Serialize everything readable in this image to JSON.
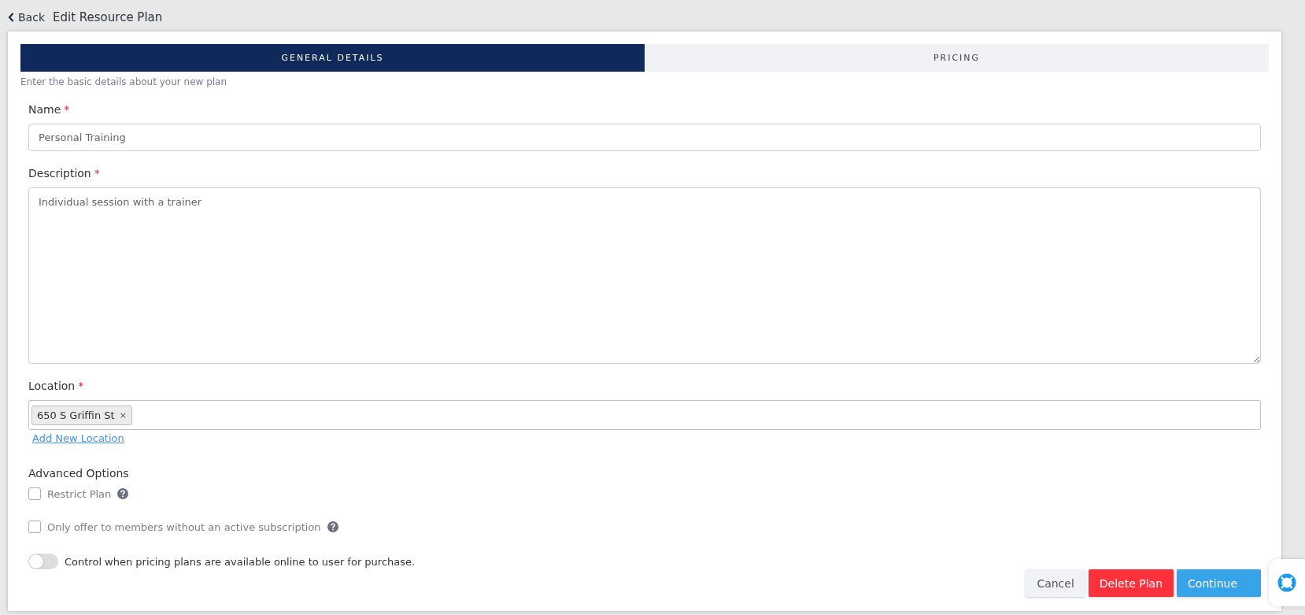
{
  "header": {
    "back": "Back",
    "title": "Edit Resource Plan"
  },
  "tabs": [
    {
      "label": "GENERAL DETAILS",
      "selected": true
    },
    {
      "label": "PRICING",
      "selected": false
    }
  ],
  "hint": "Enter the basic details about your new plan",
  "fields": [
    {
      "kind": "input",
      "label": "Name",
      "required_mark": "*",
      "value": "Personal Training"
    },
    {
      "kind": "textarea",
      "label": "Description",
      "required_mark": "*",
      "value": "Individual session with a trainer"
    },
    {
      "kind": "tags",
      "label": "Location",
      "required_mark": "*",
      "tags": [
        "650 S Griffin St"
      ],
      "tag_remove": "×",
      "link": "Add New Location"
    }
  ],
  "advanced": {
    "title": "Advanced Options",
    "options": [
      {
        "kind": "checkbox",
        "label": "Restrict Plan",
        "checked": false,
        "help": true
      },
      {
        "kind": "checkbox",
        "label": "Only offer to members without an active subscription",
        "checked": false,
        "help": true
      },
      {
        "kind": "toggle",
        "label": "Control when pricing plans are available online to user for purchase.",
        "on": false
      }
    ]
  },
  "buttons": [
    {
      "kind": "secondary",
      "label": "Cancel"
    },
    {
      "kind": "danger",
      "label": "Delete Plan"
    },
    {
      "kind": "primary",
      "label": "Continue"
    }
  ]
}
